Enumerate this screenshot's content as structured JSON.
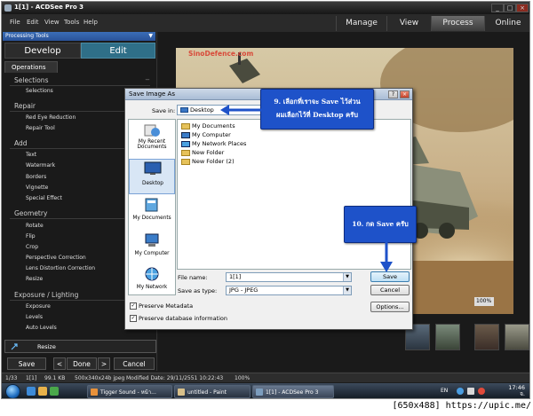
{
  "window": {
    "title": "1[1] - ACDSee Pro 3",
    "controls": [
      "_",
      "□",
      "×"
    ]
  },
  "menu": [
    "File",
    "Edit",
    "View",
    "Tools",
    "Help"
  ],
  "modes": [
    "Manage",
    "View",
    "Process",
    "Online"
  ],
  "active_mode": "Process",
  "left_panel": {
    "header": "Processing Tools",
    "tabs": [
      "Develop",
      "Edit"
    ],
    "operations_tab": "Operations",
    "groups": [
      {
        "title": "Selections",
        "items": [
          "Selections"
        ]
      },
      {
        "title": "Repair",
        "items": [
          "Red Eye Reduction",
          "Repair Tool"
        ]
      },
      {
        "title": "Add",
        "items": [
          "Text",
          "Watermark",
          "Borders",
          "Vignette",
          "Special Effect"
        ]
      },
      {
        "title": "Geometry",
        "items": [
          "Rotate",
          "Flip",
          "Crop",
          "Perspective Correction",
          "Lens Distortion Correction",
          "Resize"
        ]
      },
      {
        "title": "Exposure / Lighting",
        "items": [
          "Exposure",
          "Levels",
          "Auto Levels"
        ]
      }
    ],
    "resize_label": "Resize",
    "actions": {
      "save": "Save",
      "prev": "<",
      "done": "Done",
      "next": ">",
      "cancel": "Cancel"
    }
  },
  "image": {
    "watermark": "SinoDefence.com"
  },
  "zoom": "100%",
  "status": {
    "index": "1/33",
    "name": "1[1]",
    "size": "99.1 KB",
    "dims": "500x340x24b jpeg",
    "modified": "Modified Date: 29/11/2551 10:22:43",
    "zoom": "100%"
  },
  "taskbar": {
    "tasks": [
      "Tigger Sound - หน้า...",
      "untitled - Paint",
      "1[1] - ACDSee Pro 3"
    ],
    "lang": "EN",
    "time": "17:46",
    "day": "จ."
  },
  "dialog": {
    "title": "Save Image As",
    "save_in_label": "Save in:",
    "save_in_value": "Desktop",
    "places": [
      "My Recent Documents",
      "Desktop",
      "My Documents",
      "My Computer",
      "My Network"
    ],
    "files": [
      "My Documents",
      "My Computer",
      "My Network Places",
      "New Folder",
      "New Folder (2)"
    ],
    "file_name_label": "File name:",
    "file_name_value": "1[1]",
    "save_type_label": "Save as type:",
    "save_type_value": "JPG - JPEG",
    "buttons": {
      "save": "Save",
      "cancel": "Cancel",
      "options": "Options..."
    },
    "checkboxes": [
      "Preserve Metadata",
      "Preserve database information"
    ],
    "ctl": [
      "?",
      "×"
    ]
  },
  "annotations": {
    "step9_line1": "9. เลือกที่เราจะ Save ไว้ส่วน",
    "step9_line2": "ผมเลือกไว้ที่ Desktop ครับ",
    "step10": "10. กด Save ครับ"
  },
  "caption": "[650x488] https://upic.me/"
}
